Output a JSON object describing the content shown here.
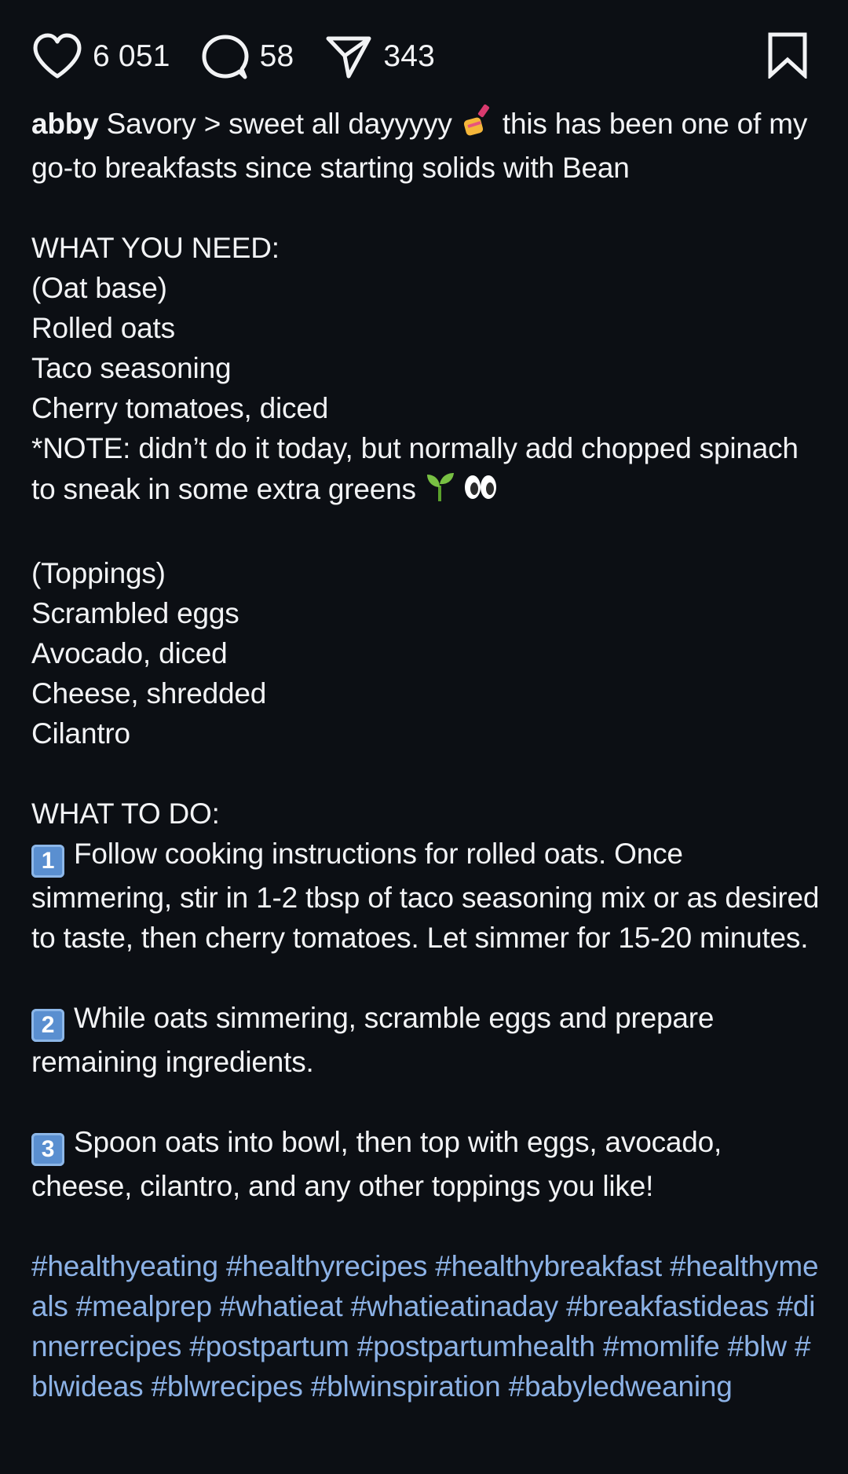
{
  "actions": {
    "likes": "6 051",
    "comments": "58",
    "shares": "343"
  },
  "caption": {
    "username": "abby",
    "intro_part1": "Savory > sweet all dayyyyy",
    "intro_emoji": "nail-polish-emoji",
    "intro_part2": "this has been one of my go-to breakfasts since starting solids with Bean",
    "need_heading": "WHAT YOU NEED:",
    "oat_base_heading": "(Oat base)",
    "oat_base_items": [
      "Rolled oats",
      "Taco seasoning",
      "Cherry tomatoes, diced"
    ],
    "note_text": "*NOTE: didn’t do it today, but normally add chopped spinach to sneak in some extra greens",
    "note_emojis": [
      "seedling-emoji",
      "eyes-emoji"
    ],
    "toppings_heading": "(Toppings)",
    "toppings_items": [
      "Scrambled eggs",
      "Avocado, diced",
      "Cheese, shredded",
      "Cilantro"
    ],
    "do_heading": "WHAT TO DO:",
    "steps": [
      {
        "number": "1",
        "text": "Follow cooking instructions for rolled oats. Once simmering, stir in 1-2 tbsp of taco seasoning mix or as desired to taste, then cherry tomatoes. Let simmer for 15-20 minutes."
      },
      {
        "number": "2",
        "text": "While oats simmering, scramble eggs and prepare remaining ingredients."
      },
      {
        "number": "3",
        "text": "Spoon oats into bowl, then top with eggs, avocado, cheese, cilantro, and any other toppings you like!"
      }
    ],
    "hashtags": [
      "#healthyeating",
      "#healthyrecipes",
      "#healthybreakfast",
      "#healthymeals",
      "#mealprep",
      "#whatieat",
      "#whatieatinaday",
      "#breakfastideas",
      "#dinnerrecipes",
      "#postpartum",
      "#postpartumhealth",
      "#momlife",
      "#blw",
      "#blwideas",
      "#blwrecipes",
      "#blwinspiration",
      "#babyledweaning"
    ]
  },
  "colors": {
    "background": "#0c0f14",
    "text": "#f2f3f5",
    "hashtag": "#8cb2e6",
    "keycap": "#5a8fd0"
  }
}
